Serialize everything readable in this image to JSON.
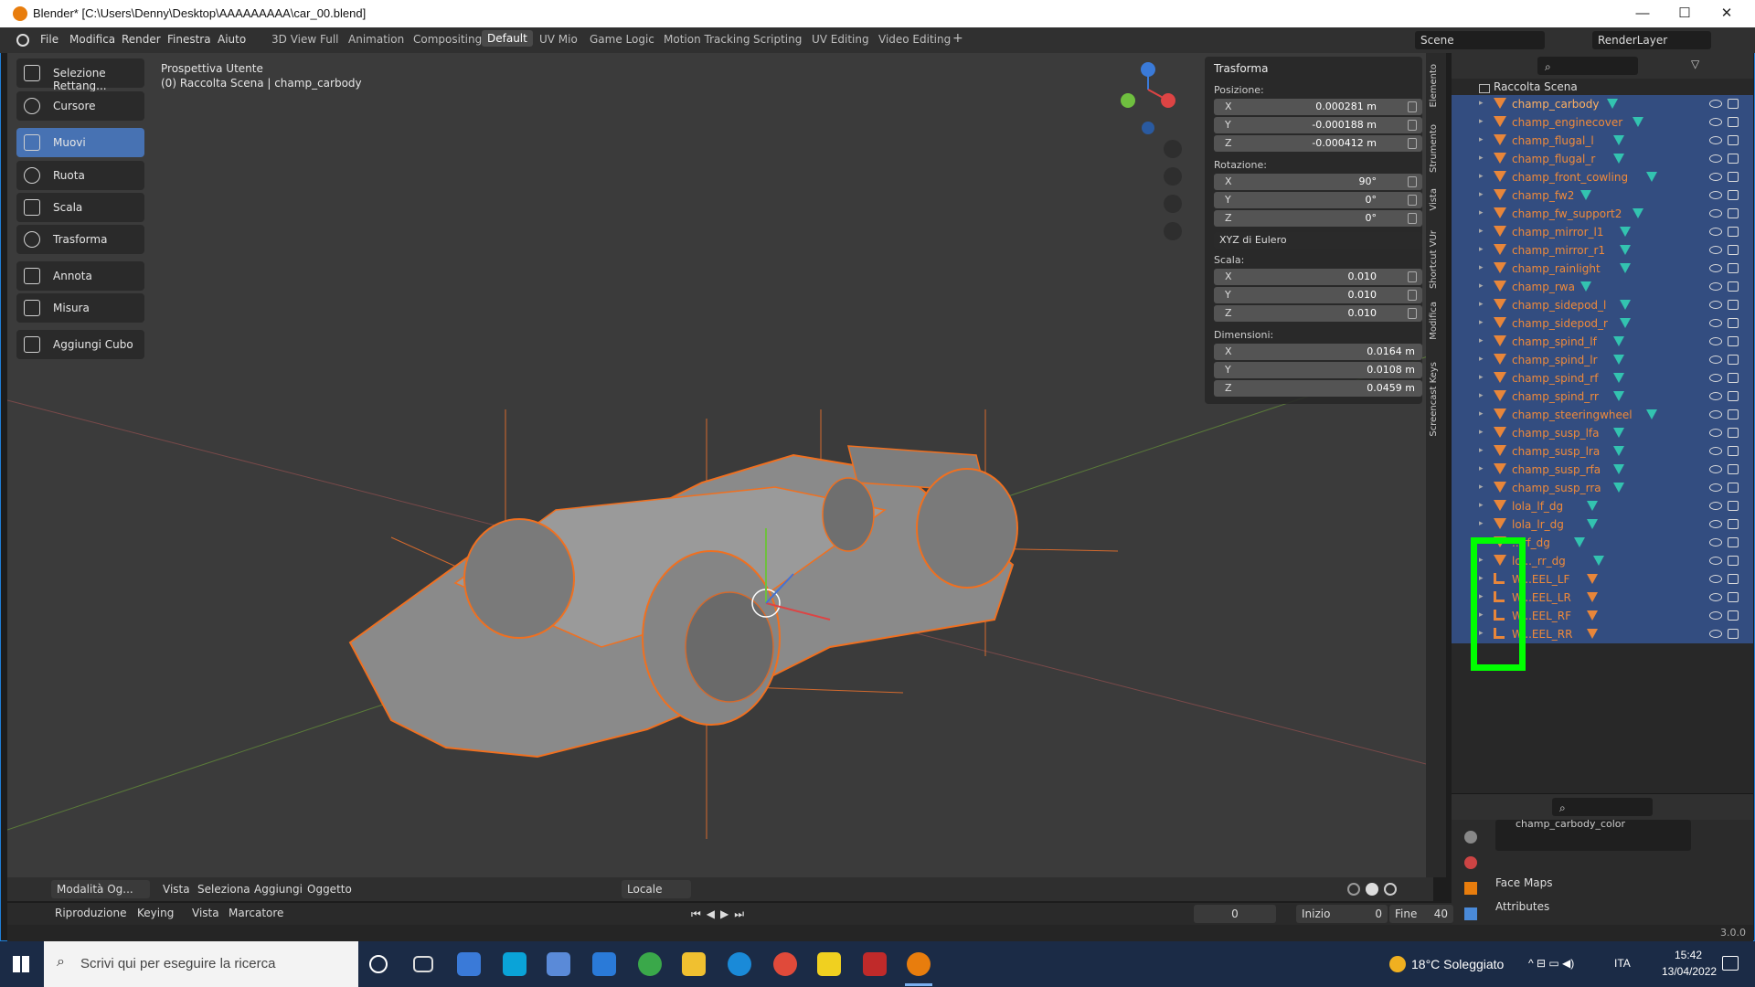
{
  "window": {
    "title": "Blender* [C:\\Users\\Denny\\Desktop\\AAAAAAAAA\\car_00.blend]",
    "controls": [
      "—",
      "☐",
      "✕"
    ]
  },
  "menubar": {
    "items": [
      "File",
      "Modifica",
      "Render",
      "Finestra",
      "Aiuto"
    ],
    "workspaces": [
      "3D View Full",
      "Animation",
      "Compositing",
      "Default",
      "UV Mio",
      "Game Logic",
      "Motion Tracking",
      "Scripting",
      "UV Editing",
      "Video Editing"
    ],
    "active_workspace": "Default",
    "add_tab": "+",
    "scene": "Scene",
    "render_layer": "RenderLayer"
  },
  "toolbar": {
    "tools": [
      {
        "label": "Selezione Rettang...",
        "icon": "select-box-icon",
        "active": false
      },
      {
        "label": "Cursore",
        "icon": "cursor-icon",
        "active": false
      },
      {
        "label": "Muovi",
        "icon": "move-icon",
        "active": true
      },
      {
        "label": "Ruota",
        "icon": "rotate-icon",
        "active": false
      },
      {
        "label": "Scala",
        "icon": "scale-icon",
        "active": false
      },
      {
        "label": "Trasforma",
        "icon": "transform-icon",
        "active": false
      },
      {
        "label": "Annota",
        "icon": "annotate-icon",
        "active": false
      },
      {
        "label": "Misura",
        "icon": "measure-icon",
        "active": false
      },
      {
        "label": "Aggiungi Cubo",
        "icon": "add-cube-icon",
        "active": false
      }
    ]
  },
  "viewport": {
    "view_name": "Prospettiva Utente",
    "context": "(0) Raccolta Scena | champ_carbody",
    "header": {
      "mode": "Modalità Og...",
      "menus": [
        "Vista",
        "Seleziona",
        "Aggiungi",
        "Oggetto"
      ],
      "orientation": "Locale"
    }
  },
  "npanel": {
    "title": "Trasforma",
    "position_label": "Posizione:",
    "position": [
      {
        "axis": "X",
        "value": "0.000281 m"
      },
      {
        "axis": "Y",
        "value": "-0.000188 m"
      },
      {
        "axis": "Z",
        "value": "-0.000412 m"
      }
    ],
    "rotation_label": "Rotazione:",
    "rotation": [
      {
        "axis": "X",
        "value": "90°"
      },
      {
        "axis": "Y",
        "value": "0°"
      },
      {
        "axis": "Z",
        "value": "0°"
      }
    ],
    "rotation_mode": "XYZ di Eulero",
    "scale_label": "Scala:",
    "scale": [
      {
        "axis": "X",
        "value": "0.010"
      },
      {
        "axis": "Y",
        "value": "0.010"
      },
      {
        "axis": "Z",
        "value": "0.010"
      }
    ],
    "dimensions_label": "Dimensioni:",
    "dimensions": [
      {
        "axis": "X",
        "value": "0.0164 m"
      },
      {
        "axis": "Y",
        "value": "0.0108 m"
      },
      {
        "axis": "Z",
        "value": "0.0459 m"
      }
    ]
  },
  "sidetabs": [
    "Elemento",
    "Strumento",
    "Vista",
    "Shortcut VUr",
    "Modifica",
    "Screencast Keys"
  ],
  "outliner": {
    "collection": "Raccolta Scena",
    "items": [
      {
        "name": "champ_carbody",
        "type": "mesh",
        "selected": true
      },
      {
        "name": "champ_enginecover",
        "type": "mesh",
        "selected": true
      },
      {
        "name": "champ_flugal_l",
        "type": "mesh",
        "selected": true
      },
      {
        "name": "champ_flugal_r",
        "type": "mesh",
        "selected": true
      },
      {
        "name": "champ_front_cowling",
        "type": "mesh",
        "selected": true
      },
      {
        "name": "champ_fw2",
        "type": "mesh",
        "selected": true
      },
      {
        "name": "champ_fw_support2",
        "type": "mesh",
        "selected": true
      },
      {
        "name": "champ_mirror_l1",
        "type": "mesh",
        "selected": true
      },
      {
        "name": "champ_mirror_r1",
        "type": "mesh",
        "selected": true
      },
      {
        "name": "champ_rainlight",
        "type": "mesh",
        "selected": true
      },
      {
        "name": "champ_rwa",
        "type": "mesh",
        "selected": true
      },
      {
        "name": "champ_sidepod_l",
        "type": "mesh",
        "selected": true
      },
      {
        "name": "champ_sidepod_r",
        "type": "mesh",
        "selected": true
      },
      {
        "name": "champ_spind_lf",
        "type": "mesh",
        "selected": true
      },
      {
        "name": "champ_spind_lr",
        "type": "mesh",
        "selected": true
      },
      {
        "name": "champ_spind_rf",
        "type": "mesh",
        "selected": true
      },
      {
        "name": "champ_spind_rr",
        "type": "mesh",
        "selected": true
      },
      {
        "name": "champ_steeringwheel",
        "type": "mesh",
        "selected": true
      },
      {
        "name": "champ_susp_lfa",
        "type": "mesh",
        "selected": true
      },
      {
        "name": "champ_susp_lra",
        "type": "mesh",
        "selected": true
      },
      {
        "name": "champ_susp_rfa",
        "type": "mesh",
        "selected": true
      },
      {
        "name": "champ_susp_rra",
        "type": "mesh",
        "selected": true
      },
      {
        "name": "lola_lf_dg",
        "type": "mesh",
        "selected": true
      },
      {
        "name": "lola_lr_dg",
        "type": "mesh",
        "selected": true
      },
      {
        "name": "...rf_dg",
        "type": "mesh",
        "selected": true
      },
      {
        "name": "lo..._rr_dg",
        "type": "mesh",
        "selected": true
      },
      {
        "name": "W...EEL_LF",
        "type": "armature",
        "selected": true
      },
      {
        "name": "W...EEL_LR",
        "type": "armature",
        "selected": true
      },
      {
        "name": "W...EEL_RF",
        "type": "armature",
        "selected": true
      },
      {
        "name": "W...EEL_RR",
        "type": "armature",
        "selected": true
      }
    ]
  },
  "properties": {
    "material_slot": "champ_carbody_color",
    "sections": [
      "Face Maps",
      "Attributes"
    ]
  },
  "timeline": {
    "menus": [
      "Riproduzione",
      "Keying",
      "Vista",
      "Marcatore"
    ],
    "current_frame": "0",
    "start_label": "Inizio",
    "start": "0",
    "end_label": "Fine",
    "end": "40"
  },
  "status": {
    "version": "3.0.0"
  },
  "taskbar": {
    "search_placeholder": "Scrivi qui per eseguire la ricerca",
    "weather": "18°C Soleggiato",
    "lang": "ITA",
    "time": "15:42",
    "date": "13/04/2022"
  },
  "colors": {
    "accent": "#4772b3",
    "selected_text": "#f08a3a",
    "highlight_box": "#00ff00"
  }
}
